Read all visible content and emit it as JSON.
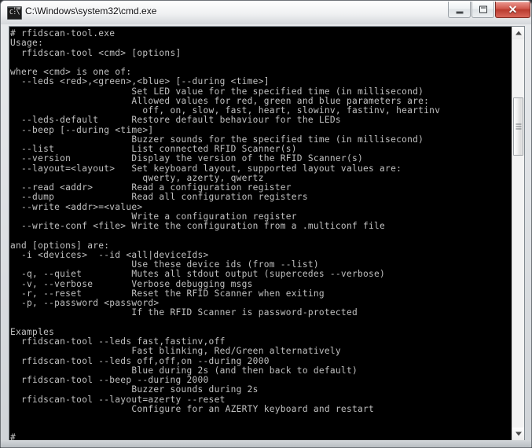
{
  "window": {
    "title": "C:\\Windows\\system32\\cmd.exe",
    "icon": "cmd-console-icon",
    "icon_glyph": "C:\\",
    "background_color": "#000000",
    "text_color": "#c0c0c0"
  },
  "caption_buttons": {
    "minimize_label": "Minimize",
    "maximize_label": "Maximize",
    "close_label": "Close",
    "close_glyph": "✕",
    "close_color": "#b93b2f"
  },
  "scrollbar": {
    "up_arrow": "scroll-up-arrow-icon",
    "down_arrow": "scroll-down-arrow-icon",
    "thumb_top_pct": 15,
    "thumb_height_pct": 15
  },
  "console": {
    "prompt": "#",
    "cursor": "_",
    "command": "rfidscan-tool.exe",
    "output": "# rfidscan-tool.exe\nUsage:\n  rfidscan-tool <cmd> [options]\n\nwhere <cmd> is one of:\n  --leds <red>,<green>,<blue> [--during <time>]\n                      Set LED value for the specified time (in millisecond)\n                      Allowed values for red, green and blue parameters are:\n                        off, on, slow, fast, heart, slowinv, fastinv, heartinv\n  --leds-default      Restore default behaviour for the LEDs\n  --beep [--during <time>]\n                      Buzzer sounds for the specified time (in millisecond)\n  --list              List connected RFID Scanner(s)\n  --version           Display the version of the RFID Scanner(s)\n  --layout=<layout>   Set keyboard layout, supported layout values are:\n                        qwerty, azerty, qwertz\n  --read <addr>       Read a configuration register\n  --dump              Read all configuration registers\n  --write <addr>=<value>\n                      Write a configuration register\n  --write-conf <file> Write the configuration from a .multiconf file\n\nand [options] are:\n  -i <devices>  --id <all|deviceIds>\n                      Use these device ids (from --list)\n  -q, --quiet         Mutes all stdout output (supercedes --verbose)\n  -v, --verbose       Verbose debugging msgs\n  -r, --reset         Reset the RFID Scanner when exiting\n  -p, --password <password>\n                      If the RFID Scanner is password-protected\n\nExamples\n  rfidscan-tool --leds fast,fastinv,off\n                      Fast blinking, Red/Green alternatively\n  rfidscan-tool --leds off,off,on --during 2000\n                      Blue during 2s (and then back to default)\n  rfidscan-tool --beep --during 2000\n                      Buzzer sounds during 2s\n  rfidscan-tool --layout=azerty --reset\n                      Configure for an AZERTY keyboard and restart\n"
  }
}
